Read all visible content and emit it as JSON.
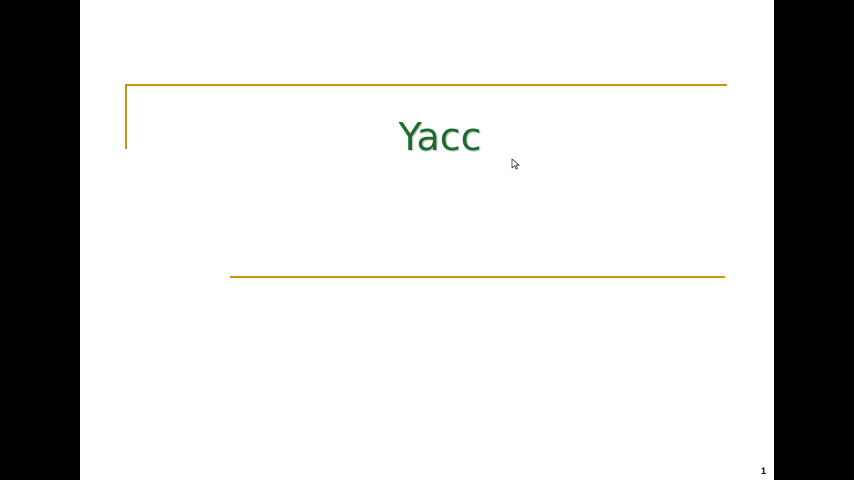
{
  "slide": {
    "title": "Yacc",
    "number": "1"
  },
  "colors": {
    "background": "#000000",
    "slide_background": "#ffffff",
    "accent_line": "#c9930b",
    "title_text": "#1e6b2e"
  },
  "icons": {
    "cursor": "mouse-pointer-icon"
  }
}
